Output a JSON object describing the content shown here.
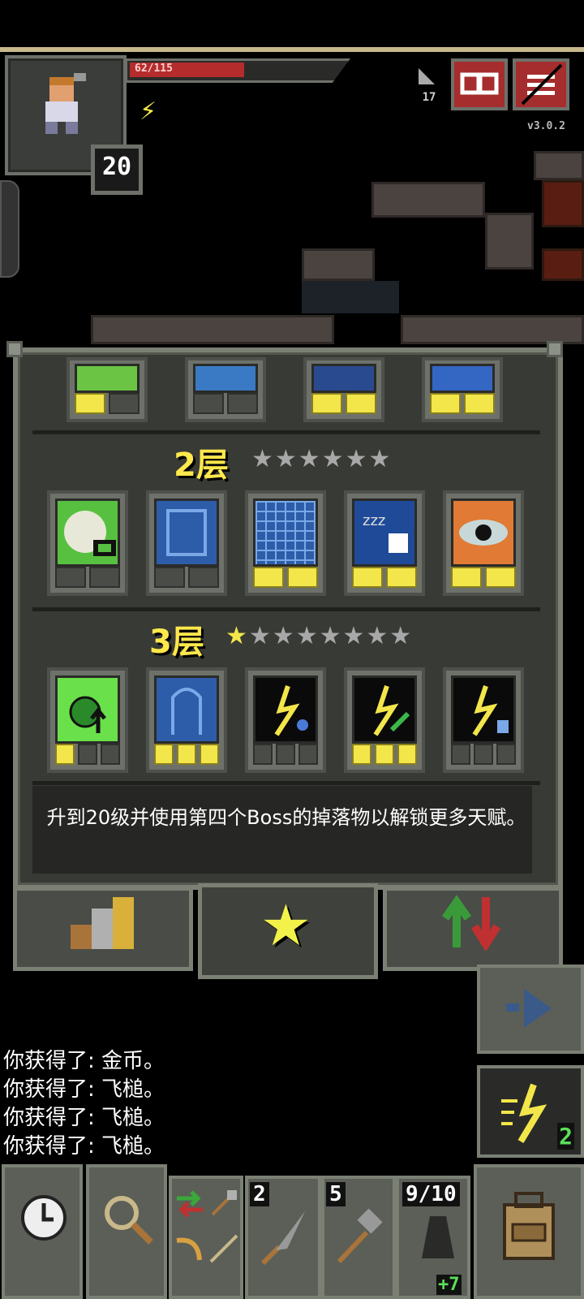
{
  "status": {
    "hp_text": "62/115",
    "hp_fraction": 0.54,
    "level": "20",
    "depth": "17",
    "version": "v3.0.2",
    "accent_red": "#a62d2d",
    "hp_color": "#b52c2c"
  },
  "top_buttons": {
    "journal_icon": "journal-icon",
    "menu_icon": "menu-icon"
  },
  "talents": {
    "tier2": {
      "title": "2层",
      "stars": "★★★★★★"
    },
    "tier3": {
      "title": "3层",
      "stars": "★★★★★★★★"
    },
    "unlock_message": "升到20级并使用第四个Boss的掉落物以解锁更多天赋。"
  },
  "log": {
    "lines": [
      "你获得了: 金币。",
      "你获得了: 飞槌。",
      "你获得了: 飞槌。",
      "你获得了: 飞槌。"
    ]
  },
  "quickslots": {
    "slot1_qty": "2",
    "slot2_qty": "5",
    "slot3_qty": "9/10",
    "slot3_bonus": "+7",
    "spell_qty": "2"
  }
}
